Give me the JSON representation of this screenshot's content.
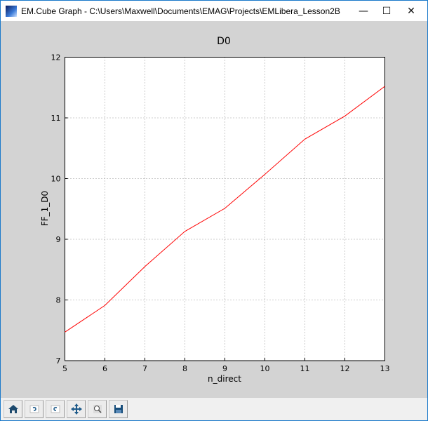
{
  "window": {
    "title": "EM.Cube Graph - C:\\Users\\Maxwell\\Documents\\EMAG\\Projects\\EMLibera_Lesson2B",
    "minimize": "—",
    "maximize": "☐",
    "close": "✕"
  },
  "toolbar": [
    {
      "icon": "home-icon",
      "label": "Home"
    },
    {
      "icon": "back-icon",
      "label": "Back"
    },
    {
      "icon": "forward-icon",
      "label": "Forward"
    },
    {
      "icon": "pan-icon",
      "label": "Pan"
    },
    {
      "icon": "zoom-icon",
      "label": "Zoom"
    },
    {
      "icon": "save-icon",
      "label": "Save"
    }
  ],
  "chart_data": {
    "type": "line",
    "title": "D0",
    "xlabel": "n_direct",
    "ylabel": "FF_1_D0",
    "xlim": [
      5,
      13
    ],
    "ylim": [
      7,
      12
    ],
    "xticks": [
      "5",
      "6",
      "7",
      "8",
      "9",
      "10",
      "11",
      "12",
      "13"
    ],
    "yticks": [
      "7",
      "8",
      "9",
      "10",
      "11",
      "12"
    ],
    "grid": true,
    "series": [
      {
        "name": "FF_1_D0",
        "color": "#ff0000",
        "x": [
          5,
          6,
          7,
          8,
          9,
          10,
          11,
          12,
          13
        ],
        "y": [
          7.47,
          7.91,
          8.55,
          9.13,
          9.51,
          10.07,
          10.65,
          11.03,
          11.52
        ]
      }
    ]
  }
}
